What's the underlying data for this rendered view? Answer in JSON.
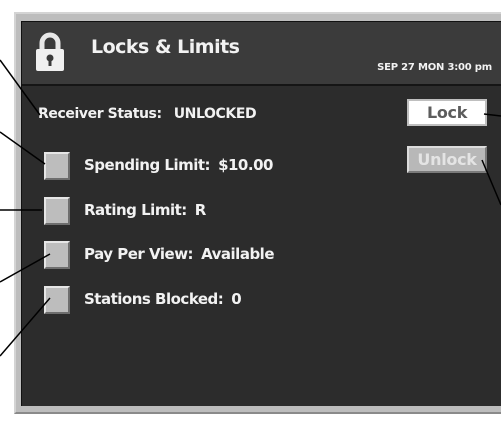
{
  "header": {
    "title": "Locks & Limits",
    "datetime": "SEP 27 MON  3:00 pm",
    "icon": "padlock-icon"
  },
  "receiver_status": {
    "label": "Receiver Status:",
    "value": "UNLOCKED"
  },
  "rows": [
    {
      "label": "Spending Limit:",
      "value": "$10.00"
    },
    {
      "label": "Rating Limit:",
      "value": "R"
    },
    {
      "label": "Pay Per View:",
      "value": "Available"
    },
    {
      "label": "Stations Blocked:",
      "value": "0"
    }
  ],
  "buttons": {
    "lock": "Lock",
    "unlock": "Unlock"
  },
  "colors": {
    "screen_background": "#2c2c2c",
    "frame": "#bdbdbd",
    "text": "#f2f2f2"
  }
}
